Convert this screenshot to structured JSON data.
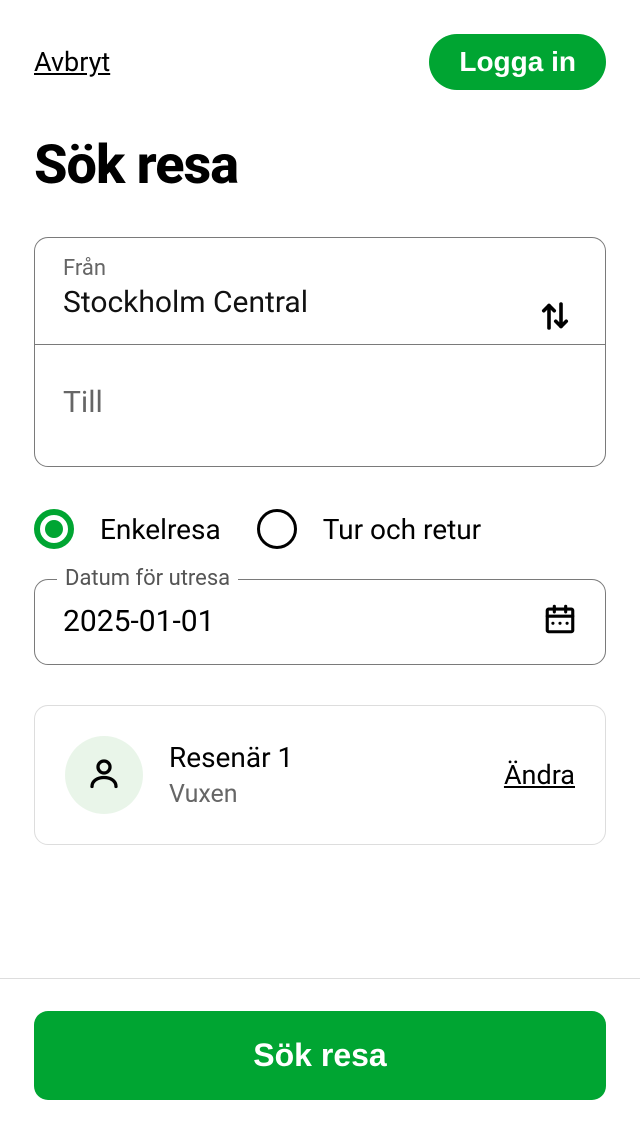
{
  "header": {
    "cancel": "Avbryt",
    "login": "Logga in"
  },
  "title": "Sök resa",
  "from": {
    "label": "Från",
    "value": "Stockholm Central"
  },
  "to": {
    "placeholder": "Till"
  },
  "tripType": {
    "oneWay": "Enkelresa",
    "roundTrip": "Tur och retur"
  },
  "date": {
    "legend": "Datum för utresa",
    "value": "2025-01-01"
  },
  "traveler": {
    "name": "Resenär 1",
    "type": "Vuxen",
    "change": "Ändra"
  },
  "searchButton": "Sök resa"
}
